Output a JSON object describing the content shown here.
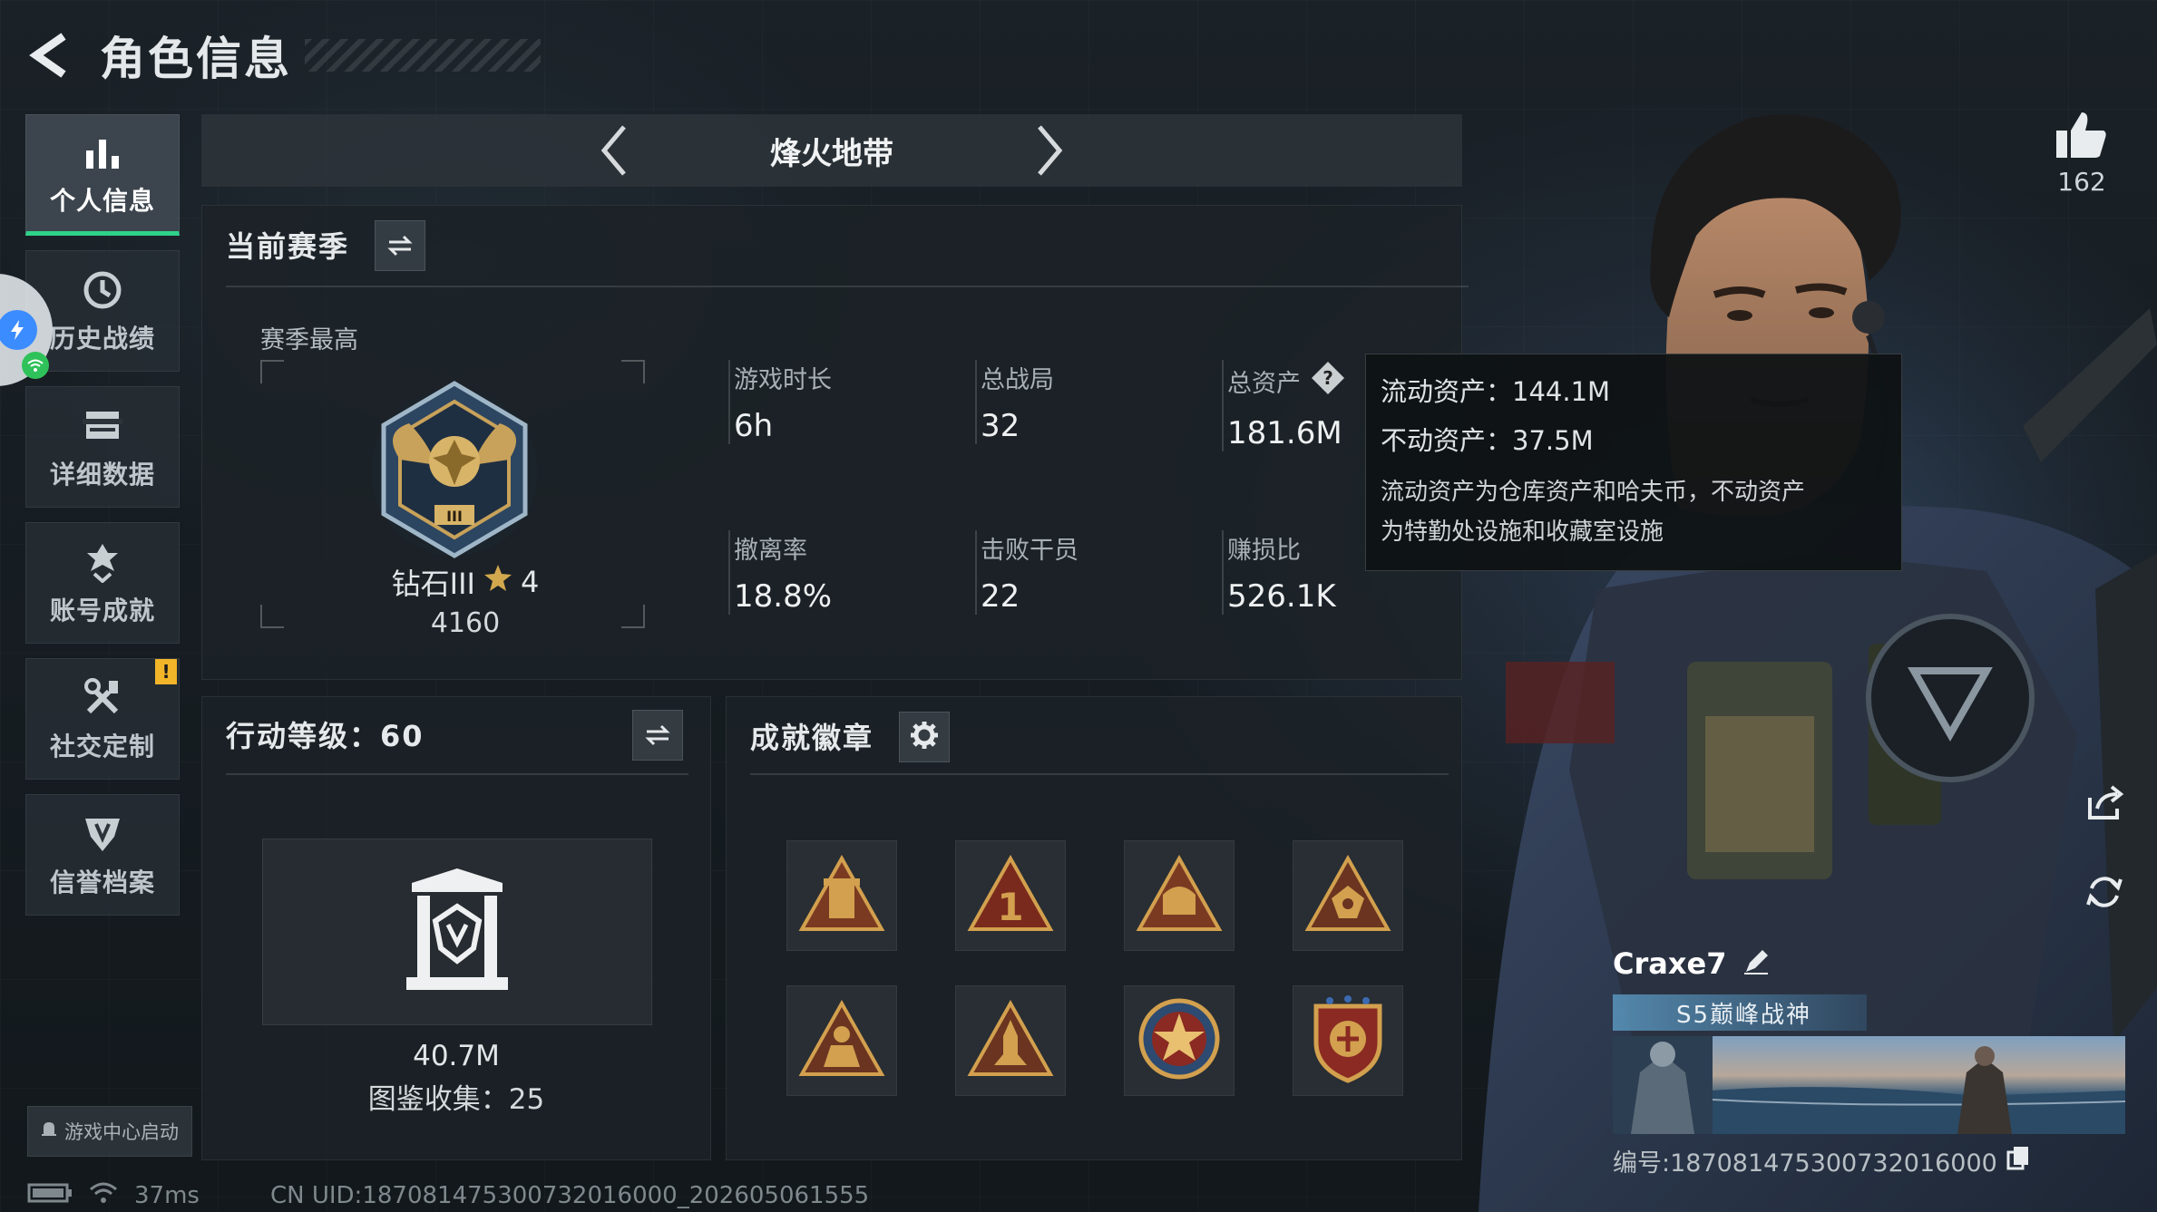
{
  "header": {
    "title": "角色信息"
  },
  "sidebar": {
    "items": [
      {
        "label": "个人信息",
        "active": true,
        "icon": "bar-chart-icon"
      },
      {
        "label": "历史战绩",
        "active": false,
        "icon": "clock-icon"
      },
      {
        "label": "详细数据",
        "active": false,
        "icon": "folder-icon"
      },
      {
        "label": "账号成就",
        "active": false,
        "icon": "achievement-icon"
      },
      {
        "label": "社交定制",
        "active": false,
        "icon": "tools-icon",
        "badge": "!"
      },
      {
        "label": "信誉档案",
        "active": false,
        "icon": "shield-icon"
      }
    ],
    "game_center_label": "游戏中心启动"
  },
  "mode": {
    "title": "烽火地带"
  },
  "season": {
    "title": "当前赛季",
    "best_label": "赛季最高",
    "rank_name": "钻石III",
    "rank_stars": "4",
    "rank_points": "4160",
    "stats": [
      {
        "label": "游戏时长",
        "value": "6h"
      },
      {
        "label": "总战局",
        "value": "32"
      },
      {
        "label": "总资产",
        "value": "181.6M"
      },
      {
        "label": "撤离率",
        "value": "18.8%"
      },
      {
        "label": "击败干员",
        "value": "22"
      },
      {
        "label": "赚损比",
        "value": "526.1K"
      }
    ]
  },
  "tooltip": {
    "liquid": "流动资产：144.1M",
    "fixed": "不动资产：37.5M",
    "desc_line1": "流动资产为仓库资产和哈夫币，不动资产",
    "desc_line2": "为特勤处设施和收藏室设施"
  },
  "action": {
    "title": "行动等级：60",
    "value": "40.7M",
    "collection": "图鉴收集：25"
  },
  "badges": {
    "title": "成就徽章",
    "items": [
      "badge-tower",
      "badge-rank-one",
      "badge-helmet",
      "badge-emblem",
      "badge-soldier",
      "badge-rocket",
      "badge-star-medal",
      "badge-shield-crest"
    ]
  },
  "likes": {
    "count": "162"
  },
  "player": {
    "name": "Craxe7",
    "title": "S5巅峰战神",
    "id_label": "编号:187081475300732016000"
  },
  "footer": {
    "ping": "37ms",
    "uid": "CN UID:187081475300732016000_202605061555"
  },
  "colors": {
    "accent": "#2fd28a",
    "warning": "#f2b428",
    "gold": "#c89a3c"
  }
}
